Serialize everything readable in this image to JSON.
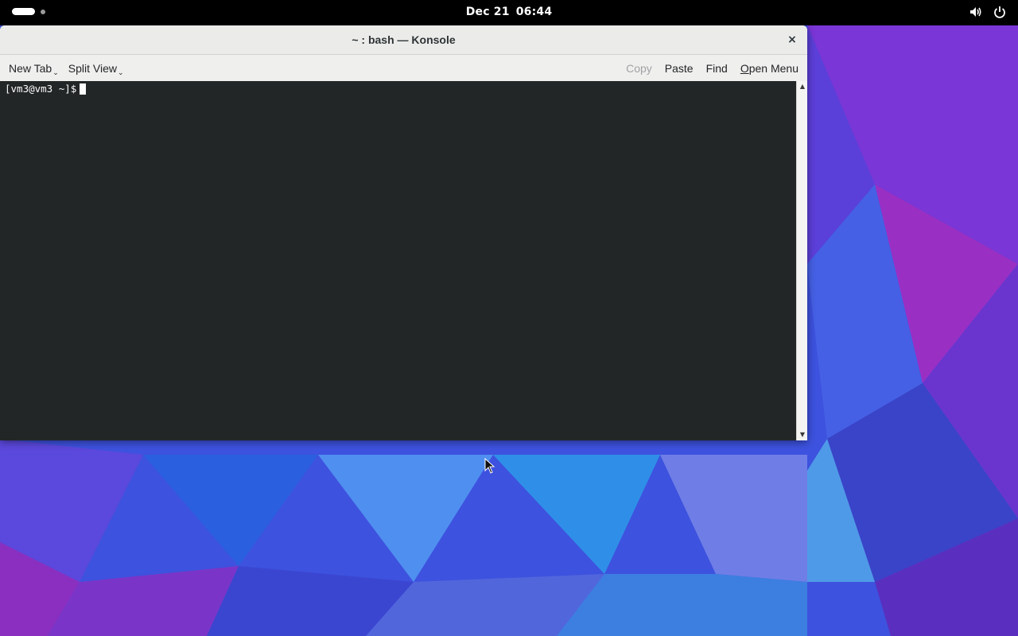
{
  "topbar": {
    "date": "Dec 21",
    "time": "06:44",
    "icons": [
      "activities-pill",
      "workspace-dot",
      "volume-icon",
      "power-icon"
    ]
  },
  "window": {
    "title": "~ : bash — Konsole",
    "close_label": "×"
  },
  "toolbar": {
    "new_tab": "New Tab",
    "split_view": "Split View",
    "copy": "Copy",
    "paste": "Paste",
    "find": "Find",
    "open_menu_first": "O",
    "open_menu_rest": "pen Menu"
  },
  "terminal": {
    "prompt": "[vm3@vm3 ~]$",
    "background": "#232627",
    "foreground": "#fcfcfc"
  },
  "colors": {
    "topbar": "#000000",
    "wallpaper_primary": "#3b4fe0",
    "wallpaper_secondary": "#8a2fc8"
  }
}
